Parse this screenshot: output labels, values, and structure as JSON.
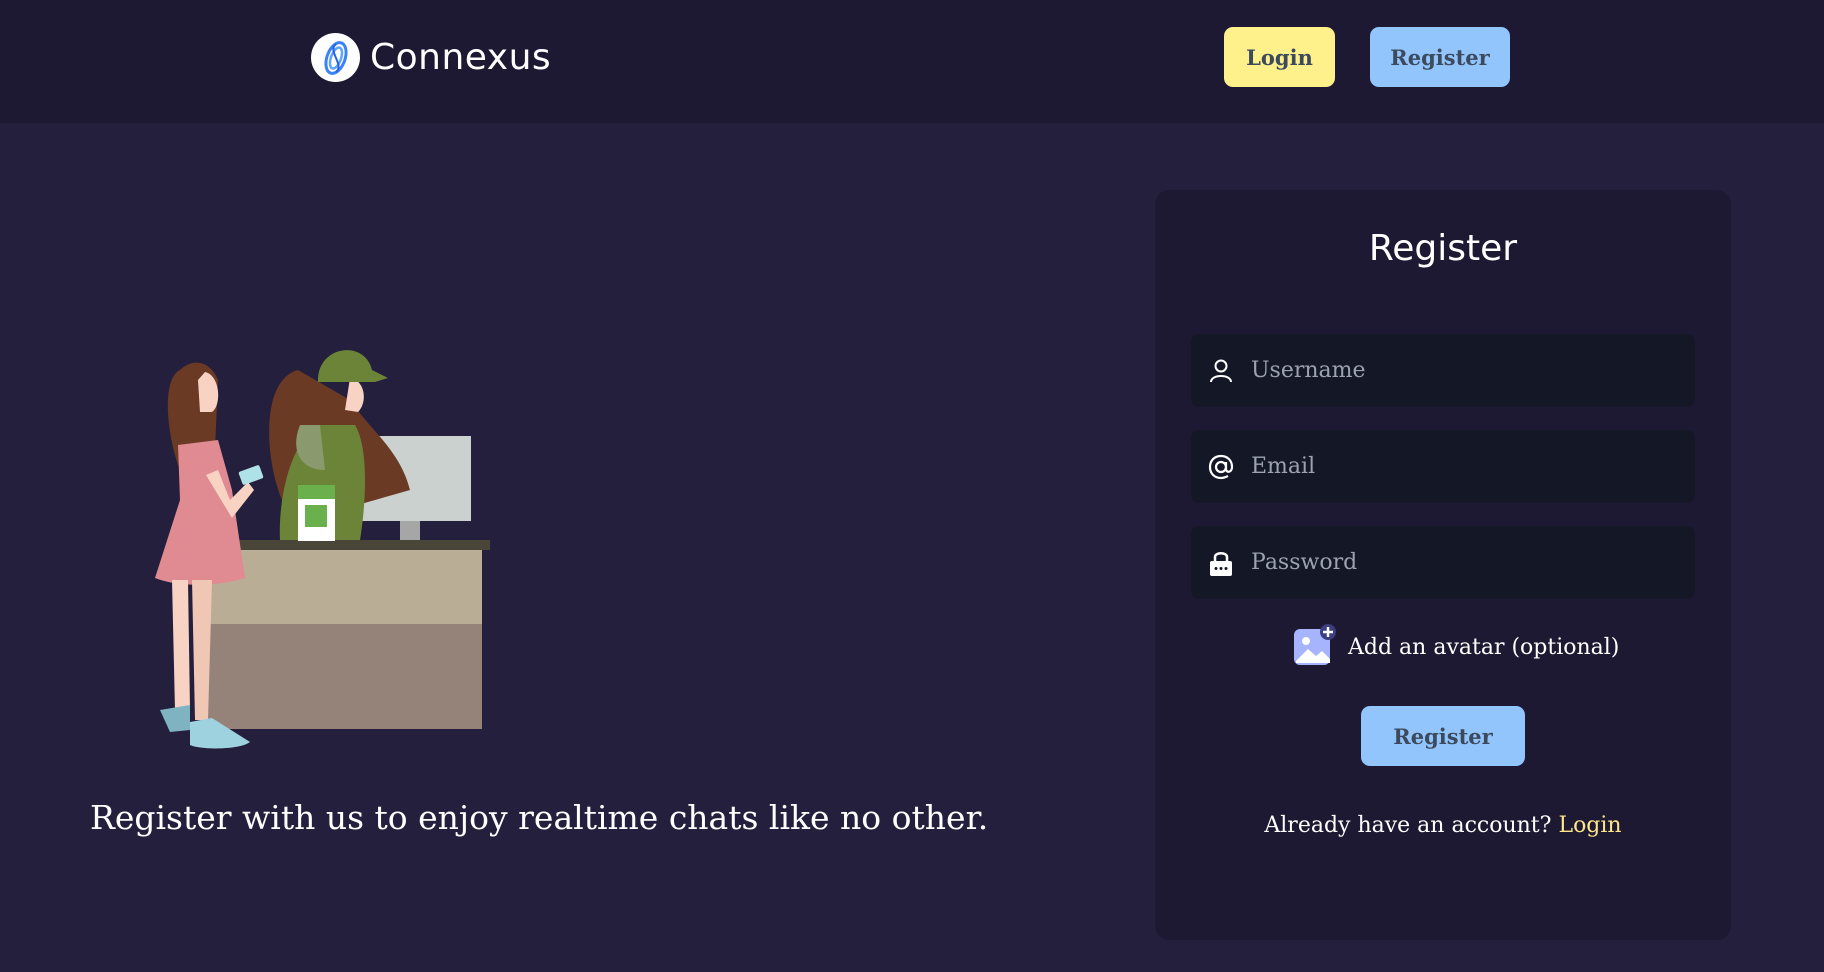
{
  "header": {
    "brand_name": "Connexus",
    "login_label": "Login",
    "register_label": "Register"
  },
  "hero": {
    "tagline": "Register with us to enjoy realtime chats like no other."
  },
  "form": {
    "title": "Register",
    "username_placeholder": "Username",
    "email_placeholder": "Email",
    "password_placeholder": "Password",
    "avatar_label": "Add an avatar (optional)",
    "submit_label": "Register",
    "login_prompt": "Already have an account?",
    "login_link": "Login"
  },
  "icons": {
    "brand": "connexus-logo-icon",
    "username": "user-icon",
    "email": "at-sign-icon",
    "password": "lock-icon",
    "avatar": "add-image-icon"
  },
  "colors": {
    "background": "#241f3d",
    "header": "#1d1933",
    "card": "#1d1933",
    "input": "#141826",
    "accent_yellow": "#fef08a",
    "accent_blue": "#93c5fd",
    "link": "#fde68a"
  }
}
